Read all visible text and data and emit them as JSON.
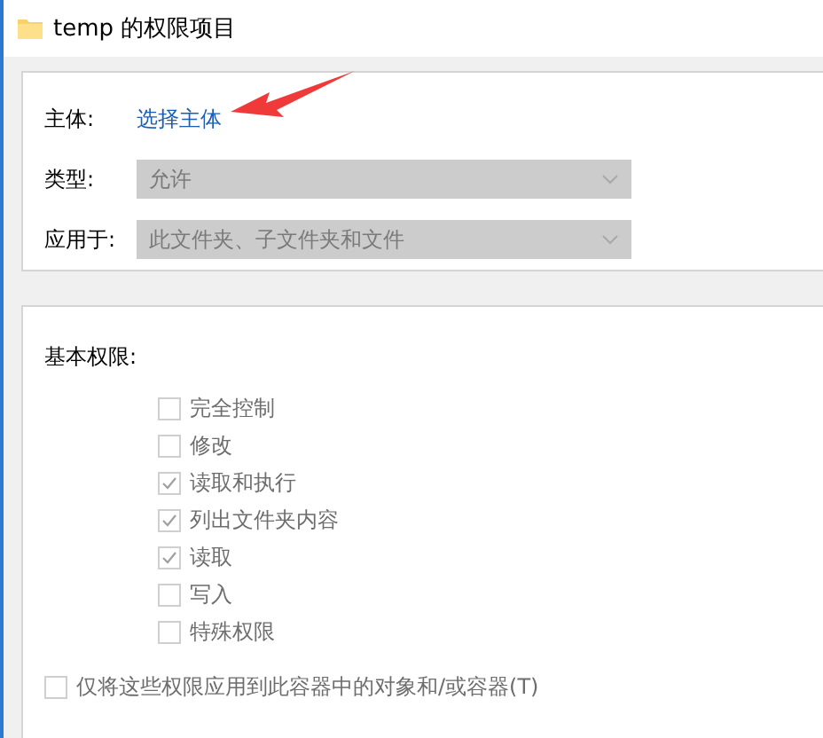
{
  "window": {
    "title": "temp 的权限项目"
  },
  "principal": {
    "label": "主体:",
    "link": "选择主体"
  },
  "type": {
    "label": "类型:",
    "value": "允许",
    "disabled": true
  },
  "applies_to": {
    "label": "应用于:",
    "value": "此文件夹、子文件夹和文件",
    "disabled": true
  },
  "annotation": {
    "kind": "arrow"
  },
  "permissions": {
    "label": "基本权限:",
    "items": [
      {
        "label": "完全控制",
        "checked": false,
        "disabled": true
      },
      {
        "label": "修改",
        "checked": false,
        "disabled": true
      },
      {
        "label": "读取和执行",
        "checked": true,
        "disabled": true
      },
      {
        "label": "列出文件夹内容",
        "checked": true,
        "disabled": true
      },
      {
        "label": "读取",
        "checked": true,
        "disabled": true
      },
      {
        "label": "写入",
        "checked": false,
        "disabled": true
      },
      {
        "label": "特殊权限",
        "checked": false,
        "disabled": true
      }
    ]
  },
  "apply_only": {
    "label": "仅将这些权限应用到此容器中的对象和/或容器(T)",
    "checked": false,
    "disabled": true
  }
}
